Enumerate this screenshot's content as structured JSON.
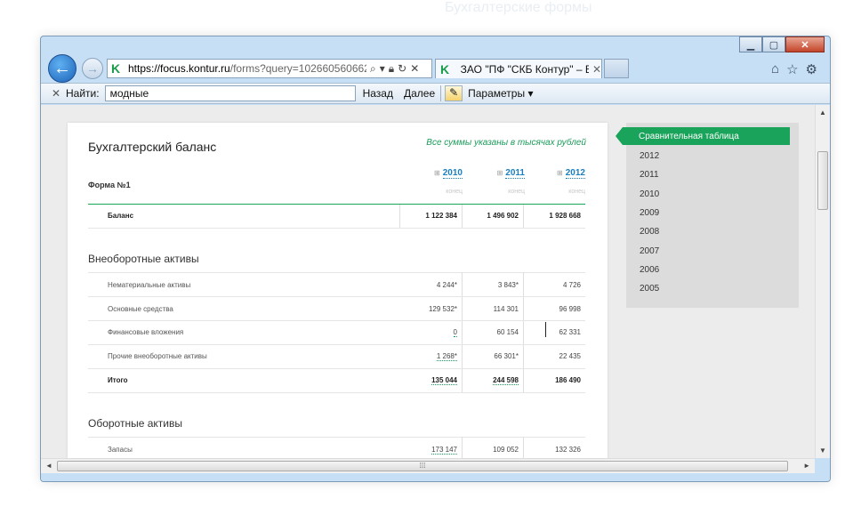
{
  "backdrop": {
    "title": "Бухгалтерские формы"
  },
  "browser": {
    "url_host": "https://focus.kontur.ru",
    "url_rest": "/forms?query=102660560662",
    "tab_title": "ЗАО \"ПФ \"СКБ Контур\" – Б...",
    "window_controls": [
      "minimize",
      "maximize",
      "close"
    ],
    "icons": [
      "home-icon",
      "star-icon",
      "gear-icon"
    ]
  },
  "findbar": {
    "label": "Найти:",
    "query": "модные",
    "prev": "Назад",
    "next": "Далее",
    "options": "Параметры"
  },
  "page": {
    "title": "Бухгалтерский баланс",
    "note": "Все суммы указаны в тысячах рублей",
    "form_label": "Форма №1",
    "years": [
      "2010",
      "2011",
      "2012"
    ],
    "year_sub": [
      "конец",
      "конец",
      "конец"
    ],
    "balance": {
      "label": "Баланс",
      "values": [
        "1 122 384",
        "1 496 902",
        "1 928 668"
      ]
    },
    "sections": [
      {
        "title": "Внеоборотные активы",
        "rows": [
          {
            "label": "Нематериальные активы",
            "values": [
              "4 244*",
              "3 843*",
              "4 726"
            ]
          },
          {
            "label": "Основные средства",
            "values": [
              "129 532*",
              "114 301",
              "96 998"
            ]
          },
          {
            "label": "Финансовые вложения",
            "values": [
              "0",
              "60 154",
              "62 331"
            ]
          },
          {
            "label": "Прочие внеоборотные активы",
            "values": [
              "1 268*",
              "66 301*",
              "22 435"
            ]
          },
          {
            "label": "Итого",
            "values": [
              "135 044",
              "244 598",
              "186 490"
            ]
          }
        ]
      },
      {
        "title": "Оборотные активы",
        "rows": [
          {
            "label": "Запасы",
            "values": [
              "173 147",
              "109 052",
              "132 326"
            ]
          }
        ]
      }
    ]
  },
  "sidebar": {
    "active": "Сравнительная таблица",
    "items": [
      "2012",
      "2011",
      "2010",
      "2009",
      "2008",
      "2007",
      "2006",
      "2005"
    ]
  },
  "colors": {
    "accent": "#1aa35a",
    "link": "#1a7fc0"
  }
}
